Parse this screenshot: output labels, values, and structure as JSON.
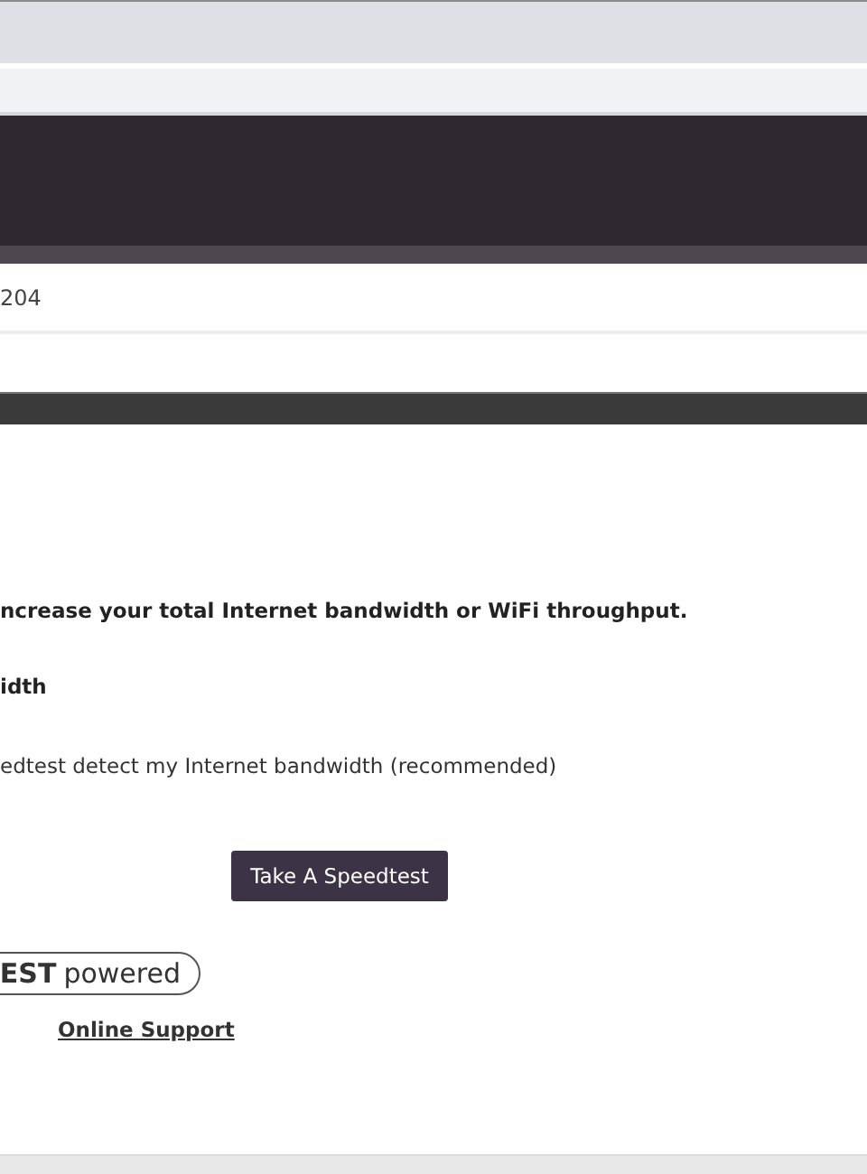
{
  "info_row": {
    "value": "204"
  },
  "notice": "ncrease your total Internet bandwidth or WiFi throughput.",
  "section_heading": "idth",
  "option_label": "edtest detect my Internet bandwidth (recommended)",
  "speedtest_button": "Take A Speedtest",
  "badge": {
    "strong": "EST",
    "rest": "powered"
  },
  "support_link": "Online Support"
}
